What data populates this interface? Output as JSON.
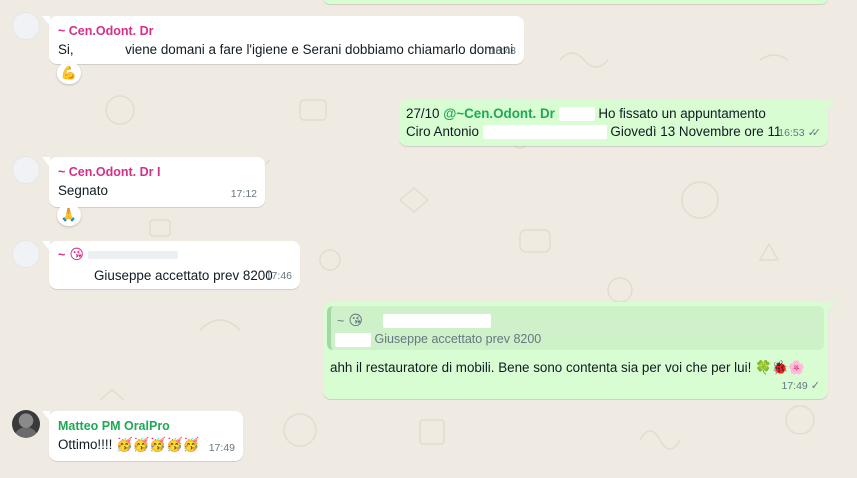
{
  "messages": [
    {
      "sender": "~ Cen.Odont. Dr",
      "text_prefix": "Si,",
      "text_suffix": "viene domani a fare l'igiene e Serani dobbiamo chiamarlo domani",
      "time": "16:43",
      "reaction": "💪"
    },
    {
      "date_prefix": "27/10",
      "mention": "@~Cen.Odont. Dr",
      "line1_suffix": "Ho fissato un appuntamento",
      "line2_prefix": "Ciro Antonio",
      "line2_suffix": "Giovedì 13 Novembre ore 11",
      "time": "16:53",
      "status": "read"
    },
    {
      "sender": "~ Cen.Odont. Dr I",
      "text": "Segnato",
      "time": "17:12",
      "reaction": "🙏"
    },
    {
      "sender_prefix": "~",
      "sender_emoji": "😘",
      "text": "Giuseppe accettato prev 8200",
      "time": "17:46"
    },
    {
      "quote_sender_prefix": "~",
      "quote_sender_emoji": "😘",
      "quote_text": "Giuseppe accettato prev 8200",
      "text": "ahh il restauratore di mobili. Bene sono contenta sia per voi che per lui!",
      "text_emojis": "🍀🐞🌸",
      "time": "17:49",
      "status": "sent"
    },
    {
      "sender": "Matteo PM OralPro",
      "text": "Ottimo!!!!",
      "text_emojis": "🥳🥳🥳🥳🥳",
      "time": "17:49"
    }
  ],
  "colors": {
    "chat_background": "#efeae2",
    "incoming_bubble": "#ffffff",
    "outgoing_bubble": "#d9fdd3",
    "sender_pink": "#d52f8a",
    "sender_green": "#1fa855"
  },
  "icons": {
    "read_receipt": "double-check-icon",
    "sent_receipt": "single-check-icon"
  }
}
